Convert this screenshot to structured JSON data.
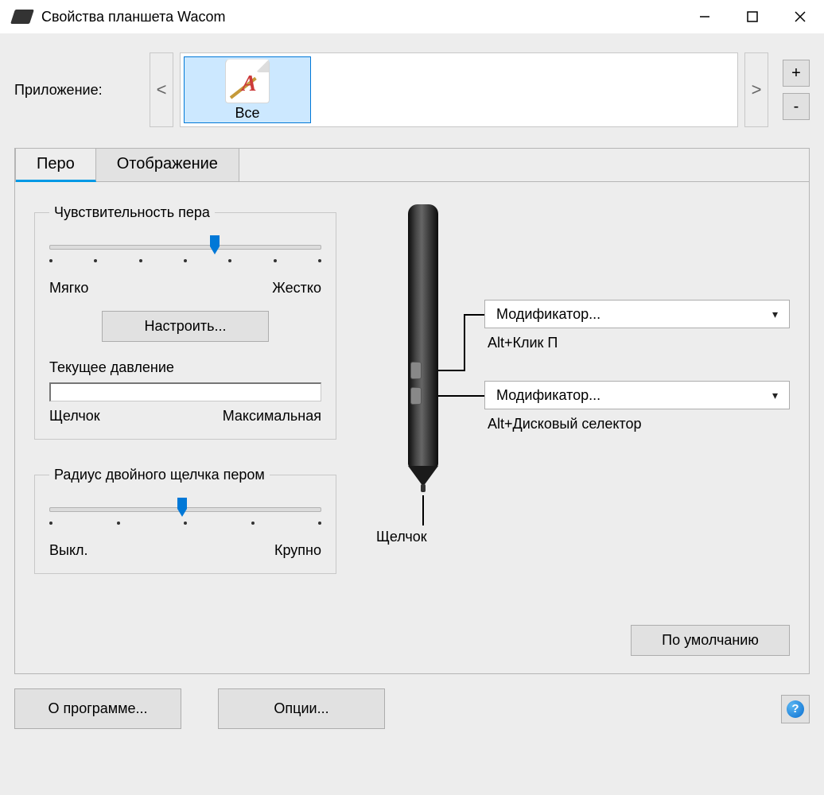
{
  "window": {
    "title": "Свойства планшета Wacom"
  },
  "appRow": {
    "label": "Приложение:",
    "item_label": "Все",
    "scroll_left": "<",
    "scroll_right": ">",
    "add": "+",
    "remove": "-"
  },
  "tabs": {
    "pen": "Перо",
    "mapping": "Отображение"
  },
  "pen": {
    "tip_feel_group": "Чувствительность пера",
    "soft": "Мягко",
    "firm": "Жестко",
    "customize": "Настроить...",
    "current_pressure_label": "Текущее давление",
    "click": "Щелчок",
    "max": "Максимальная",
    "dbl_click_group": "Радиус двойного щелчка пером",
    "off": "Выкл.",
    "large": "Крупно",
    "tip_label": "Щелчок",
    "button_upper": {
      "value": "Модификатор...",
      "sub": "Alt+Клик П"
    },
    "button_lower": {
      "value": "Модификатор...",
      "sub": "Alt+Дисковый селектор"
    }
  },
  "footer": {
    "defaults": "По умолчанию",
    "about": "О программе...",
    "options": "Опции..."
  }
}
